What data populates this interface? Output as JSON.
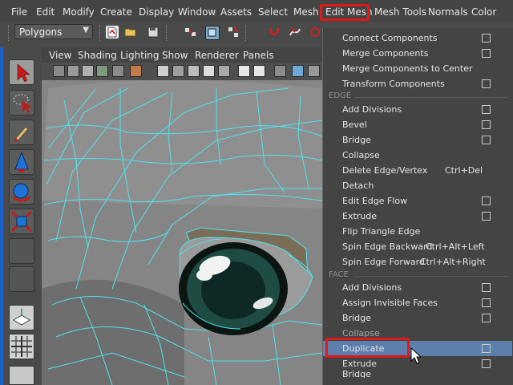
{
  "menubar": {
    "items": [
      "File",
      "Edit",
      "Modify",
      "Create",
      "Display",
      "Window",
      "Assets",
      "Select",
      "Mesh",
      "Edit Mesh",
      "Mesh Tools",
      "Normals",
      "Color"
    ]
  },
  "shelf": {
    "mode_select": "Polygons"
  },
  "panel": {
    "menu": [
      "View",
      "Shading",
      "Lighting",
      "Show",
      "Renderer",
      "Panels"
    ]
  },
  "dropdown": {
    "top_items": [
      {
        "label": "Connect Components",
        "option_box": true
      },
      {
        "label": "Merge Components",
        "option_box": true
      },
      {
        "label": "Merge Components to Center",
        "option_box": false
      },
      {
        "label": "Transform Components",
        "option_box": true
      }
    ],
    "edge_header": "EDGE",
    "edge_items": [
      {
        "label": "Add Divisions",
        "shortcut": "",
        "option_box": true
      },
      {
        "label": "Bevel",
        "shortcut": "",
        "option_box": true
      },
      {
        "label": "Bridge",
        "shortcut": "",
        "option_box": true
      },
      {
        "label": "Collapse",
        "shortcut": "",
        "option_box": false
      },
      {
        "label": "Delete Edge/Vertex",
        "shortcut": "Ctrl+Del",
        "option_box": false
      },
      {
        "label": "Detach",
        "shortcut": "",
        "option_box": false
      },
      {
        "label": "Edit Edge Flow",
        "shortcut": "",
        "option_box": true
      },
      {
        "label": "Extrude",
        "shortcut": "",
        "option_box": true
      },
      {
        "label": "Flip Triangle Edge",
        "shortcut": "",
        "option_box": false
      },
      {
        "label": "Spin Edge Backward",
        "shortcut": "Ctrl+Alt+Left",
        "option_box": false
      },
      {
        "label": "Spin Edge Forward",
        "shortcut": "Ctrl+Alt+Right",
        "option_box": false
      }
    ],
    "face_header": "FACE",
    "face_items": [
      {
        "label": "Add Divisions",
        "option_box": true
      },
      {
        "label": "Assign Invisible Faces",
        "option_box": true
      },
      {
        "label": "Bridge",
        "option_box": true
      },
      {
        "label": "Collapse",
        "option_box": false
      },
      {
        "label": "Duplicate",
        "option_box": true
      },
      {
        "label": "Extrude",
        "option_box": true
      },
      {
        "label": "Bridge",
        "option_box": false
      }
    ]
  },
  "colors": {
    "highlight_red": "#e01818",
    "selected_row": "#5c7fab",
    "wireframe": "#4fe3ec",
    "eye": "#1f4b45"
  },
  "icons": [
    "select-arrow-icon",
    "lasso-icon",
    "paint-select-icon",
    "move-icon",
    "rotate-icon",
    "scale-icon",
    "layout-single-icon",
    "layout-four-icon",
    "mouse-cursor-icon"
  ]
}
